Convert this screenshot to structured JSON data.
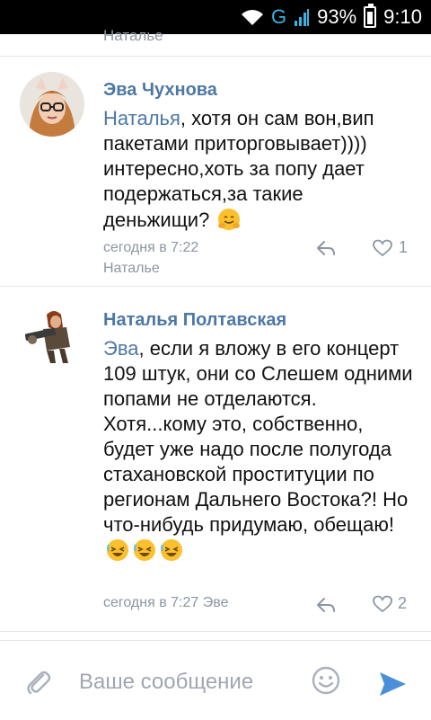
{
  "statusbar": {
    "battery": "93%",
    "time": "9:10",
    "network": "G"
  },
  "previous": {
    "reply_to": "Наталье"
  },
  "comments": [
    {
      "author": "Эва Чухнова",
      "mention": "Наталья",
      "text": ", хотя он сам вон,вип пакетами приторговывает)))) интересно,хоть за попу дает подержаться,за такие деньжищи? ",
      "time": "сегодня в 7:22",
      "reply_to": "Наталье",
      "likes": "1"
    },
    {
      "author": "Наталья Полтавская",
      "mention": "Эва",
      "text": ", если я вложу в его концерт 109 штук, они со Слешем одними попами не отделаются. Хотя...кому это, собственно, будет уже надо после полугода стахановской проституции по регионам Дальнего Востока?! Но что-нибудь придумаю, обещаю!",
      "time": "сегодня в 7:27",
      "reply_to": "Эве",
      "likes": "2"
    }
  ],
  "composer": {
    "placeholder": "Ваше сообщение"
  }
}
